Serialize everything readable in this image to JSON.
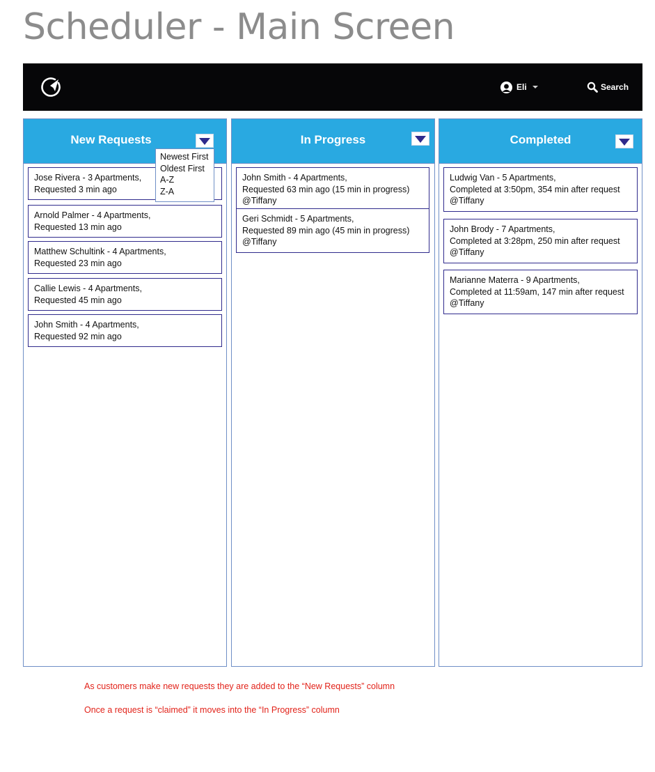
{
  "page": {
    "title": "Scheduler - Main Screen"
  },
  "header": {
    "user": {
      "name": "Eli"
    },
    "search": {
      "label": "Search"
    }
  },
  "columns": [
    {
      "title": "New Requests",
      "cards": [
        {
          "line1": "Jose Rivera - 3 Apartments,",
          "line2": "Requested 3 min ago"
        },
        {
          "line1": "Arnold Palmer - 4 Apartments,",
          "line2": "Requested 13 min ago"
        },
        {
          "line1": "Matthew Schultink - 4 Apartments,",
          "line2": "Requested 23 min ago"
        },
        {
          "line1": "Callie Lewis - 4 Apartments,",
          "line2": "Requested 45 min ago"
        },
        {
          "line1": "John Smith - 4 Apartments,",
          "line2": "Requested 92 min ago"
        }
      ]
    },
    {
      "title": "In Progress",
      "cards": [
        {
          "line1": "John Smith - 4 Apartments,",
          "line2": "Requested 63 min ago (15 min in progress)",
          "line3": "@Tiffany"
        },
        {
          "line1": "Geri Schmidt - 5 Apartments,",
          "line2": "Requested 89 min ago (45 min in progress)",
          "line3": "@Tiffany"
        }
      ]
    },
    {
      "title": "Completed",
      "cards": [
        {
          "line1": "Ludwig Van - 5 Apartments,",
          "line2": "Completed at 3:50pm, 354 min after request",
          "line3": "@Tiffany"
        },
        {
          "line1": "John Brody - 7 Apartments,",
          "line2": "Completed at 3:28pm, 250 min after request",
          "line3": "@Tiffany"
        },
        {
          "line1": "Marianne Materra - 9 Apartments,",
          "line2": "Completed at 11:59am, 147 min after request",
          "line3": "@Tiffany"
        }
      ]
    }
  ],
  "sort_menu": {
    "options": [
      "Newest First",
      "Oldest First",
      "A-Z",
      "Z-A"
    ]
  },
  "notes": [
    "As customers make new requests they are added to the “New Requests” column",
    "Once a request is “claimed” it moves into the “In Progress” column"
  ],
  "colors": {
    "header_bar": "#060608",
    "column_header": "#29a9e1",
    "card_border": "#2f2a8c",
    "note_text": "#e2231a"
  },
  "icons": {
    "logo": "navigation-arrow-circle",
    "user": "user-avatar",
    "search": "magnifier",
    "dropdown": "triangle-down"
  }
}
